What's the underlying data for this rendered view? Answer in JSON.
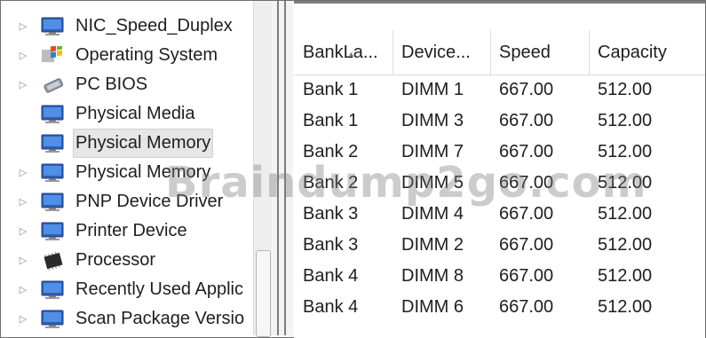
{
  "tree": {
    "items": [
      {
        "label": "NIC_Speed_Duplex",
        "icon": "monitor-icon",
        "expandable": true
      },
      {
        "label": "Operating System",
        "icon": "windows-logo-icon",
        "expandable": true
      },
      {
        "label": "PC BIOS",
        "icon": "bios-chip-icon",
        "expandable": true
      },
      {
        "label": "Physical Media",
        "icon": "monitor-icon",
        "expandable": false
      },
      {
        "label": "Physical Memory",
        "icon": "monitor-icon",
        "expandable": false,
        "selected": true
      },
      {
        "label": "Physical Memory",
        "icon": "monitor-icon",
        "expandable": true
      },
      {
        "label": "PNP Device Driver",
        "icon": "monitor-icon",
        "expandable": true
      },
      {
        "label": "Printer Device",
        "icon": "monitor-icon",
        "expandable": true
      },
      {
        "label": "Processor",
        "icon": "processor-chip-icon",
        "expandable": true
      },
      {
        "label": "Recently Used Applic",
        "icon": "monitor-icon",
        "expandable": true
      },
      {
        "label": "Scan Package Versio",
        "icon": "monitor-icon",
        "expandable": true
      }
    ],
    "expander_glyph": "▷"
  },
  "list": {
    "columns": [
      "BankLa...",
      "Device...",
      "Speed",
      "Capacity"
    ],
    "rows": [
      [
        "Bank 1",
        "DIMM 1",
        "667.00",
        "512.00"
      ],
      [
        "Bank 1",
        "DIMM 3",
        "667.00",
        "512.00"
      ],
      [
        "Bank 2",
        "DIMM 7",
        "667.00",
        "512.00"
      ],
      [
        "Bank 2",
        "DIMM 5",
        "667.00",
        "512.00"
      ],
      [
        "Bank 3",
        "DIMM 4",
        "667.00",
        "512.00"
      ],
      [
        "Bank 3",
        "DIMM 2",
        "667.00",
        "512.00"
      ],
      [
        "Bank 4",
        "DIMM 8",
        "667.00",
        "512.00"
      ],
      [
        "Bank 4",
        "DIMM 6",
        "667.00",
        "512.00"
      ]
    ],
    "sort_glyph": "▲"
  },
  "watermark": "Braindump2go.com",
  "colors": {
    "selection": "#e6e6e6",
    "border": "#7d7d7d",
    "text": "#1e1e1e"
  }
}
